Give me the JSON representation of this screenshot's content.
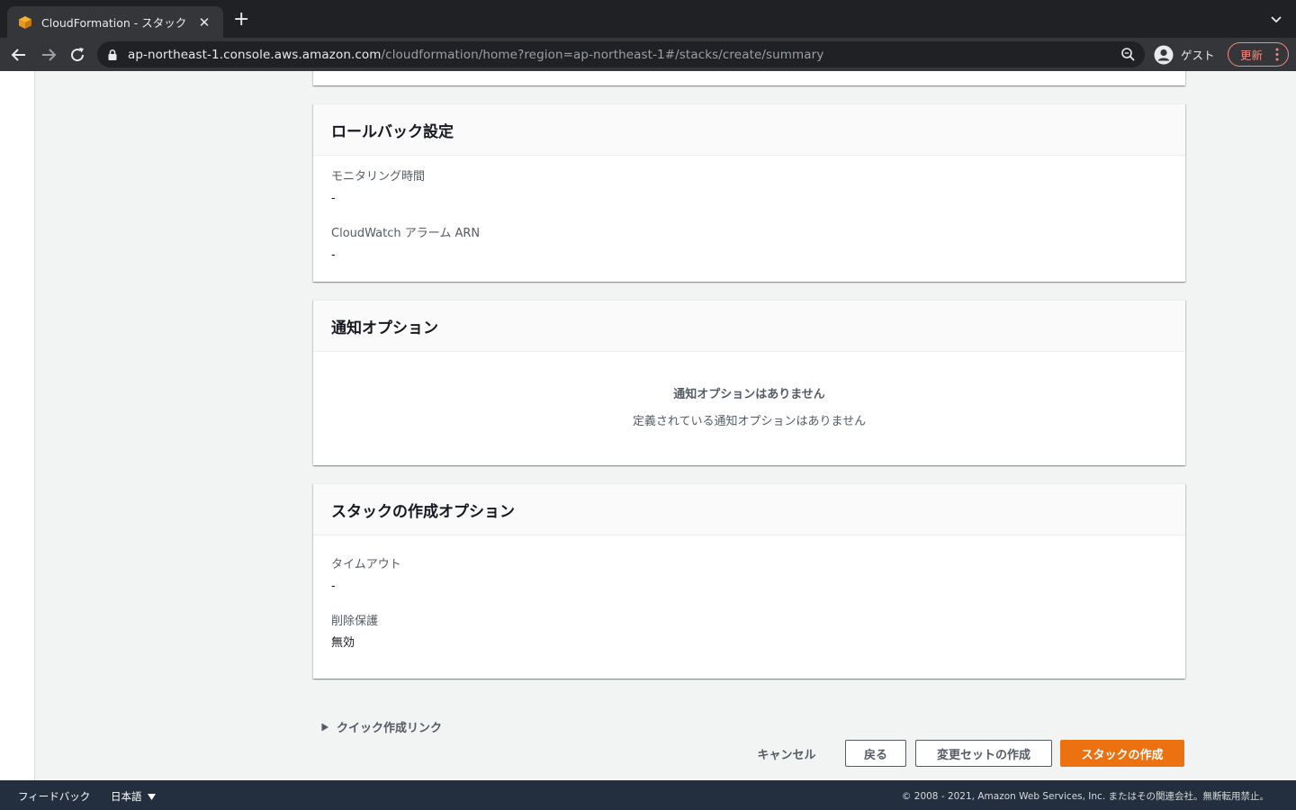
{
  "browser": {
    "tab_title": "CloudFormation - スタック",
    "url_host": "ap-northeast-1.console.aws.amazon.com",
    "url_path": "/cloudformation/home?region=ap-northeast-1#/stacks/create/summary",
    "profile_label": "ゲスト",
    "update_label": "更新"
  },
  "rollback": {
    "title": "ロールバック設定",
    "monitoring_label": "モニタリング時間",
    "monitoring_value": "-",
    "alarm_label": "CloudWatch アラーム ARN",
    "alarm_value": "-"
  },
  "notifications": {
    "title": "通知オプション",
    "empty_title": "通知オプションはありません",
    "empty_desc": "定義されている通知オプションはありません"
  },
  "stack_options": {
    "title": "スタックの作成オプション",
    "timeout_label": "タイムアウト",
    "timeout_value": "-",
    "termination_label": "削除保護",
    "termination_value": "無効"
  },
  "quick_link_label": "クイック作成リンク",
  "actions": {
    "cancel": "キャンセル",
    "back": "戻る",
    "create_changeset": "変更セットの作成",
    "create_stack": "スタックの作成"
  },
  "footer": {
    "feedback": "フィードバック",
    "language": "日本語",
    "copyright": "© 2008 - 2021, Amazon Web Services, Inc. またはその関連会社。無断転用禁止。"
  },
  "colors": {
    "primary_button": "#ec7211",
    "footer_bg": "#232f3e",
    "update_accent": "#f28b82"
  }
}
